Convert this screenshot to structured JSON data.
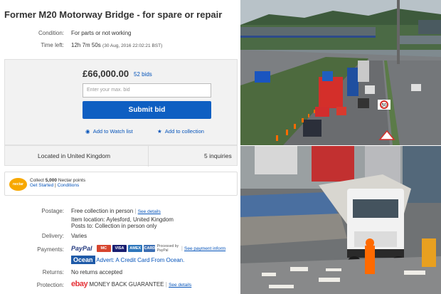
{
  "listing": {
    "title": "Former M20 Motorway Bridge - for spare or repair",
    "condition_label": "Condition:",
    "condition_value": "For parts or not working",
    "time_left_label": "Time left:",
    "time_left_value": "12h 7m 50s",
    "time_left_detail": "(30 Aug, 2016 22:02:21 BST)"
  },
  "bid": {
    "price": "£66,000.00",
    "bids": "52 bids",
    "max_bid_placeholder": "Enter your max. bid",
    "submit_label": "Submit bid",
    "watch_label": "Add to Watch list",
    "collection_label": "Add to collection"
  },
  "location": {
    "located": "Located in United Kingdom",
    "inquiries": "5 inquiries"
  },
  "nectar": {
    "logo": "nectar",
    "line1_prefix": "Collect ",
    "line1_points": "5,000",
    "line1_suffix": " Nectar points",
    "get_started": "Get Started",
    "divider": " | ",
    "conditions": "Conditions"
  },
  "details": {
    "postage_label": "Postage:",
    "postage_value": "Free collection in person",
    "postage_link": "See details",
    "item_location": "Item location:  Aylesford, United Kingdom",
    "posts_to": "Posts to:  Collection in person only",
    "delivery_label": "Delivery:",
    "delivery_value": "Varies",
    "payments_label": "Payments:",
    "paypal": "PayPal",
    "card_mastercard": "MC",
    "card_visa": "VISA",
    "card_amex": "AMEX",
    "card_generic": "CARD",
    "processed_by": "Processed by PayPal",
    "payment_link": "See payment inform",
    "ocean_logo": "Ocean",
    "ocean_advert": "Advert: A Credit Card From Ocean.",
    "returns_label": "Returns:",
    "returns_value": "No returns accepted",
    "protection_label": "Protection:",
    "ebay_logo": "ebay",
    "money_back": "MONEY BACK GUARANTEE",
    "protection_link": "See details"
  },
  "signs": {
    "speed_limit": "50"
  },
  "colors": {
    "ebay_blue": "#0654ba",
    "submit_blue": "#0e5fc2",
    "nectar_orange": "#f7a800"
  }
}
